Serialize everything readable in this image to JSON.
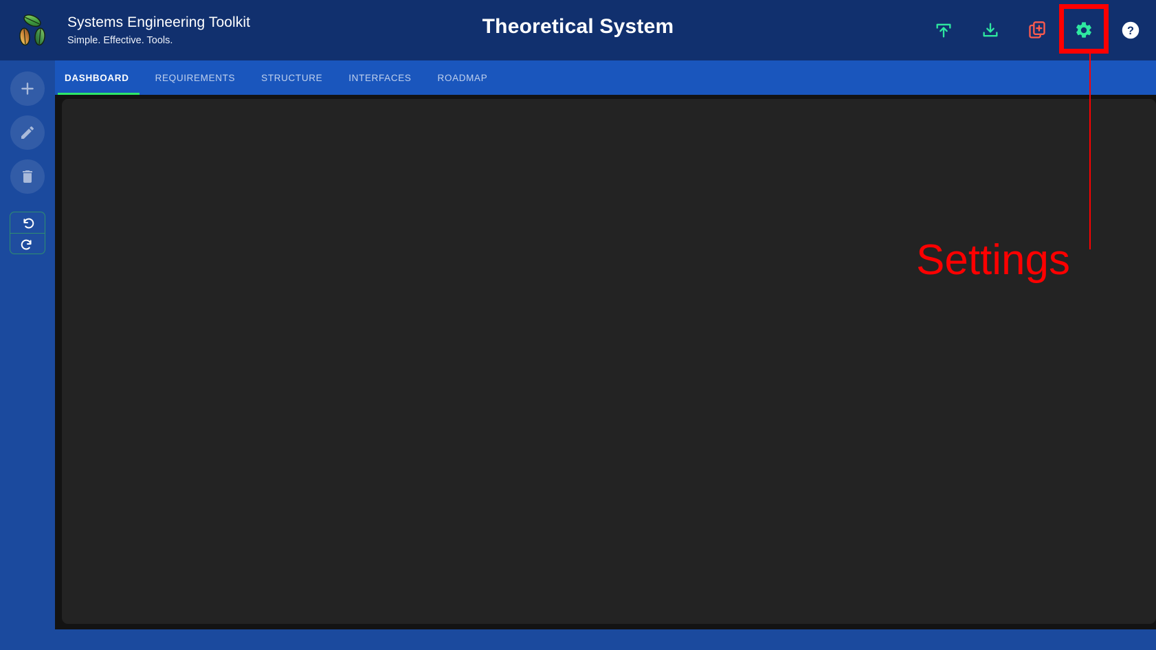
{
  "app": {
    "brand_title": "Systems Engineering Toolkit",
    "brand_tagline": "Simple. Effective. Tools.",
    "logo_icon": "three-leaves-recycle-logo"
  },
  "header": {
    "document_title": "Theoretical System",
    "actions": [
      {
        "name": "upload-button",
        "icon": "upload-icon",
        "color": "#2ee8a0",
        "label": "Upload"
      },
      {
        "name": "download-button",
        "icon": "download-icon",
        "color": "#2ee8a0",
        "label": "Download"
      },
      {
        "name": "new-project-button",
        "icon": "new-file-plus-icon",
        "color": "#ff5b4d",
        "label": "New Project"
      },
      {
        "name": "settings-button",
        "icon": "gear-icon",
        "color": "#2ee8a0",
        "label": "Settings"
      },
      {
        "name": "help-button",
        "icon": "help-circle-icon",
        "color": "#ffffff",
        "label": "Help"
      }
    ]
  },
  "annotation": {
    "label": "Settings",
    "color": "#ff0000",
    "target": "settings-button",
    "highlight_color": "#ff0000"
  },
  "sidebar": {
    "buttons": [
      {
        "name": "add-button",
        "icon": "plus-icon",
        "label": "Add",
        "enabled": false
      },
      {
        "name": "edit-button",
        "icon": "pencil-icon",
        "label": "Edit",
        "enabled": false
      },
      {
        "name": "delete-button",
        "icon": "trash-icon",
        "label": "Delete",
        "enabled": false
      }
    ],
    "history": [
      {
        "name": "undo-button",
        "icon": "undo-arrow-icon",
        "label": "Undo"
      },
      {
        "name": "redo-button",
        "icon": "redo-arrow-icon",
        "label": "Redo"
      }
    ]
  },
  "tabs": {
    "active": "DASHBOARD",
    "items": [
      {
        "label": "DASHBOARD"
      },
      {
        "label": "REQUIREMENTS"
      },
      {
        "label": "STRUCTURE"
      },
      {
        "label": "INTERFACES"
      },
      {
        "label": "ROADMAP"
      }
    ]
  },
  "content": {
    "body_text": ""
  },
  "colors": {
    "header_bg": "#11306e",
    "tabbar_bg": "#1a56bd",
    "page_bg": "#1b4a9e",
    "content_bg": "#232323",
    "accent_green": "#2ee86a",
    "accent_teal": "#2ee8a0",
    "accent_red": "#ff5b4d",
    "annotation_red": "#ff0000"
  }
}
